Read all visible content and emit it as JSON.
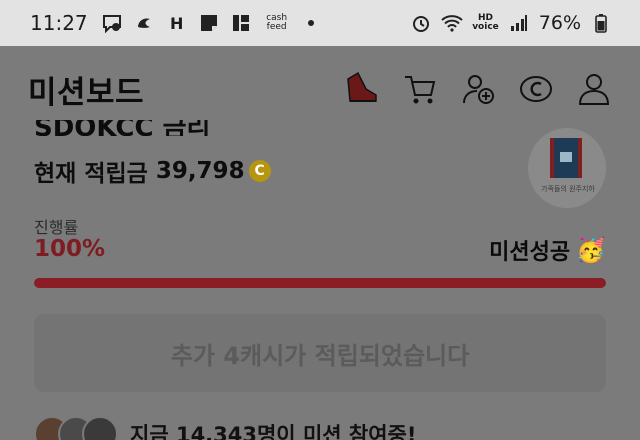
{
  "status_bar": {
    "time": "11:27",
    "icons": [
      "chat-icon",
      "thread-icon",
      "h-icon",
      "note-icon",
      "grid-icon",
      "cashfeed-icon"
    ],
    "h_label": "H",
    "cash_label": "cash\nfeed",
    "hd_label": "HD\nvoice",
    "battery": "76%"
  },
  "app_bar": {
    "title": "미션보드",
    "actions": [
      "shoe-icon",
      "cart-icon",
      "add-friend-icon",
      "coin-icon",
      "profile-icon"
    ]
  },
  "mission": {
    "name_cut": "SDOKCC 금리",
    "points_label": "현재 적립금",
    "points_value": "39,798",
    "coin_symbol": "C",
    "thumb_caption": "가족들의 원주지하",
    "progress_label": "진행률",
    "progress_percent_text": "100%",
    "progress_fraction": 1.0,
    "status_text": "미션성공",
    "status_emoji": "🥳",
    "notice_text": "추가 4캐시가 적립되었습니다"
  },
  "participants": {
    "text": "지금 14,343명이 미션 참여중!"
  },
  "colors": {
    "accent_red": "#e0303a",
    "overlay": "#7a7a7a"
  }
}
